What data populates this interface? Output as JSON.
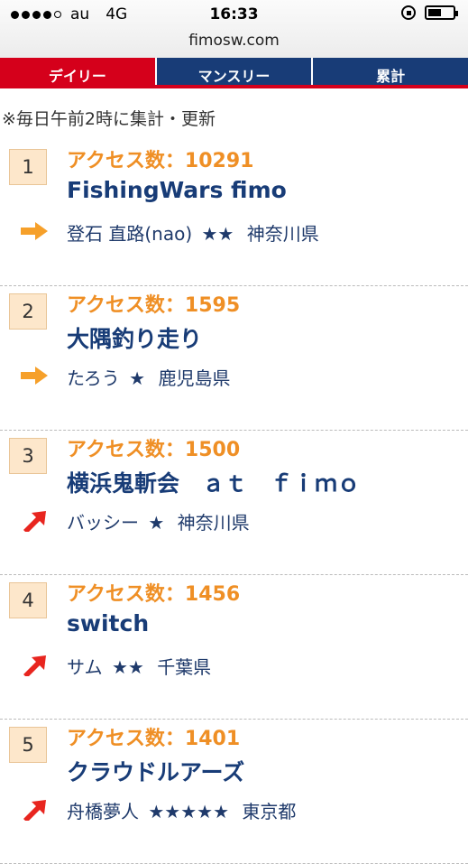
{
  "status_bar": {
    "carrier": "au",
    "network": "4G",
    "time": "16:33",
    "url": "fimosw.com"
  },
  "tabs": [
    {
      "label": "デイリー"
    },
    {
      "label": "マンスリー"
    },
    {
      "label": "累計"
    }
  ],
  "notice": "※毎日午前2時に集計・更新",
  "ranking": [
    {
      "rank": "1",
      "access": "アクセス数：10291",
      "title": "FishingWars fimo",
      "user": "登石 直路(nao)",
      "stars": "★★",
      "region": "神奈川県",
      "trend": "flat"
    },
    {
      "rank": "2",
      "access": "アクセス数：1595",
      "title": "大隅釣り走り",
      "user": "たろう",
      "stars": "★",
      "region": "鹿児島県",
      "trend": "flat"
    },
    {
      "rank": "3",
      "access": "アクセス数：1500",
      "title": "横浜鬼斬会　ａｔ　ｆｉｍｏ",
      "user": "バッシー",
      "stars": "★",
      "region": "神奈川県",
      "trend": "up"
    },
    {
      "rank": "4",
      "access": "アクセス数：1456",
      "title": "switch",
      "user": "サム",
      "stars": "★★",
      "region": "千葉県",
      "trend": "up"
    },
    {
      "rank": "5",
      "access": "アクセス数：1401",
      "title": "クラウドルアーズ",
      "user": "舟橋夢人",
      "stars": "★★★★★",
      "region": "東京都",
      "trend": "up"
    }
  ],
  "colors": {
    "accent_red": "#d5001b",
    "tab_blue": "#183c77",
    "access_orange": "#ef8f25",
    "arrow_orange": "#f6a02a",
    "arrow_red": "#e8251f"
  }
}
